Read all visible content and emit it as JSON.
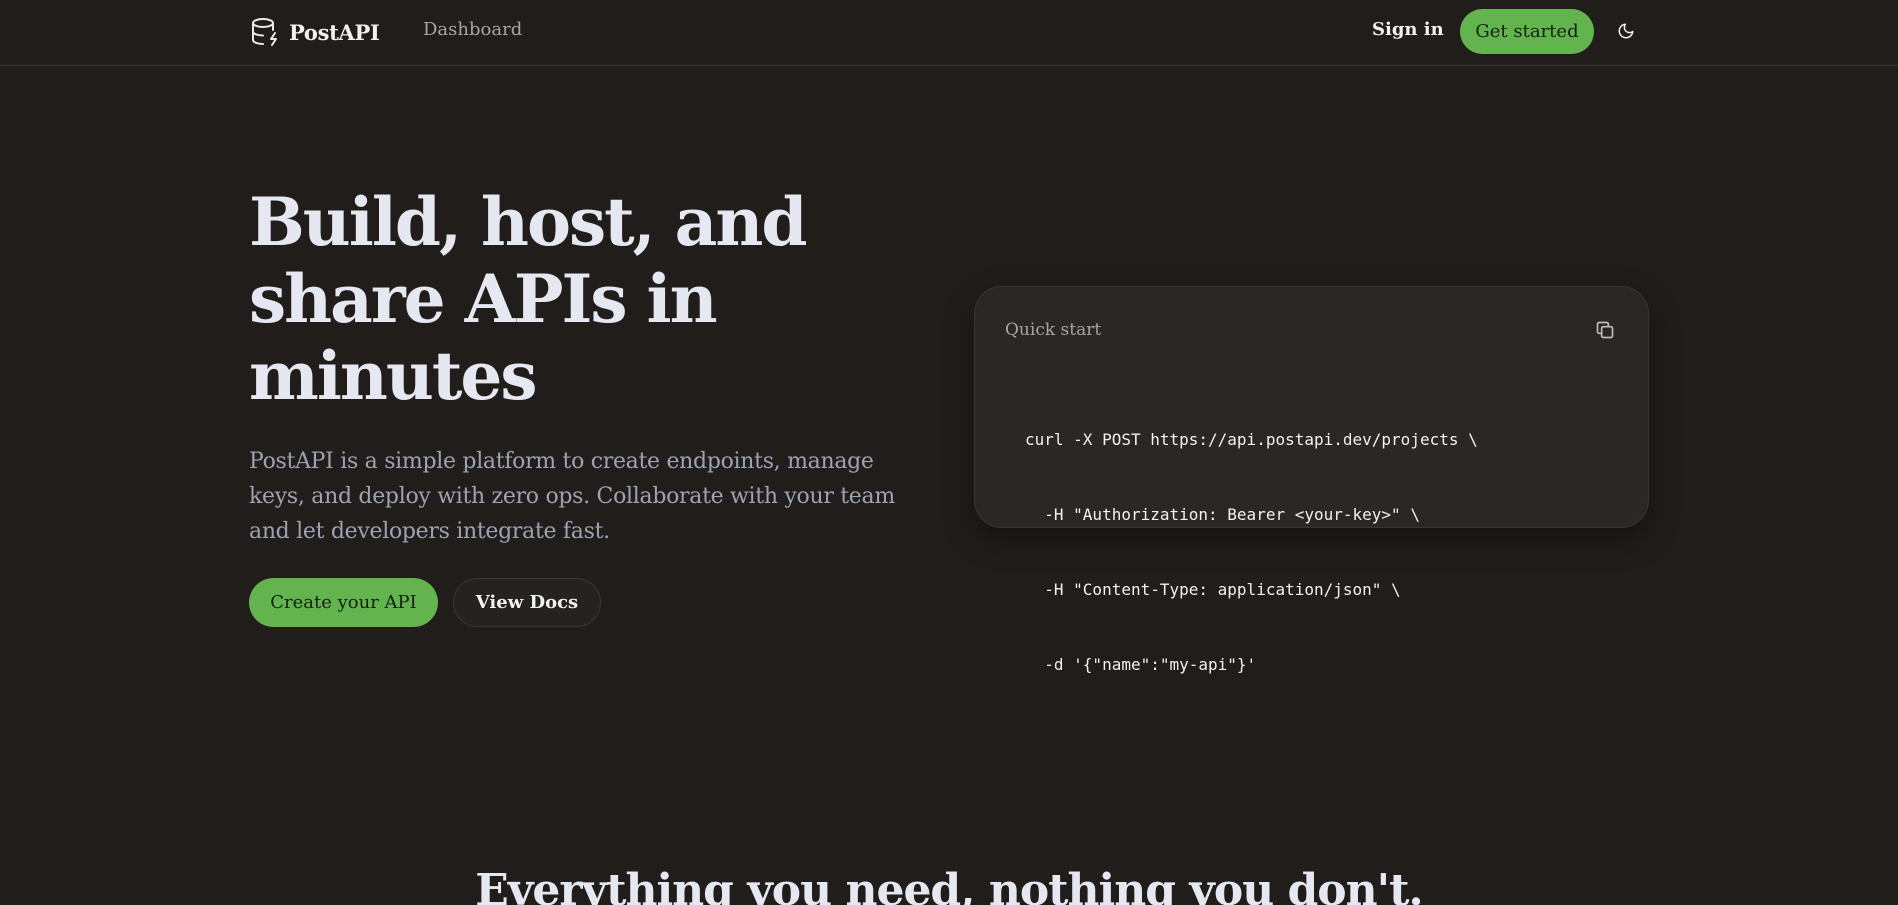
{
  "nav": {
    "brand_name": "PostAPI",
    "brand_icon": "database-bolt-icon",
    "dashboard_label": "Dashboard",
    "signin_label": "Sign in",
    "get_started_label": "Get started",
    "theme_icon": "moon-icon"
  },
  "hero": {
    "title": "Build, host, and share APIs in minutes",
    "description": "PostAPI is a simple platform to create endpoints, manage keys, and deploy with zero ops. Collaborate with your team and let developers integrate fast.",
    "primary_cta": "Create your API",
    "secondary_cta": "View Docs"
  },
  "quick_start": {
    "title": "Quick start",
    "copy_icon": "copy-icon",
    "code_lines": [
      "curl -X POST https://api.postapi.dev/projects \\",
      "  -H \"Authorization: Bearer <your-key>\" \\",
      "  -H \"Content-Type: application/json\" \\",
      "  -d '{\"name\":\"my-api\"}'"
    ]
  },
  "features": {
    "heading": "Everything you need, nothing you don't."
  },
  "colors": {
    "background": "#201d1b",
    "accent_green": "#63b34f",
    "card_background": "#2a2724",
    "muted_text": "#9ea3b3"
  }
}
